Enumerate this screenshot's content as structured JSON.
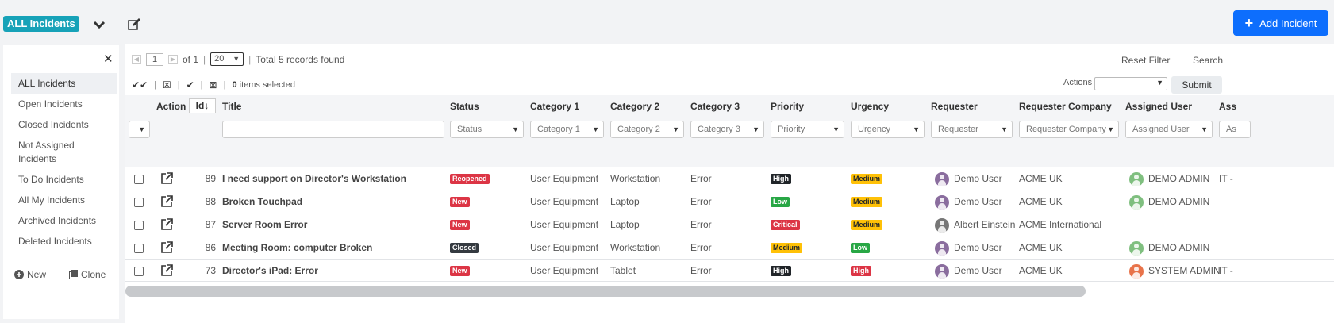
{
  "header": {
    "title": "ALL Incidents",
    "add_button": "Add Incident",
    "chevron_icon": "chevron-down-icon",
    "edit_icon": "edit-icon"
  },
  "sidebar": {
    "items": [
      {
        "label": "ALL Incidents",
        "active": true
      },
      {
        "label": "Open Incidents"
      },
      {
        "label": "Closed Incidents"
      },
      {
        "label": "Not Assigned Incidents"
      },
      {
        "label": "To Do Incidents"
      },
      {
        "label": "All My Incidents"
      },
      {
        "label": "Archived Incidents"
      },
      {
        "label": "Deleted Incidents"
      }
    ],
    "new_label": "New",
    "clone_label": "Clone"
  },
  "toolbar": {
    "page": "1",
    "of_pages": "of 1",
    "page_size": "20",
    "total": "Total 5 records found",
    "reset_filter": "Reset Filter",
    "search": "Search",
    "items_selected_count": "0",
    "items_selected_text": "items selected",
    "actions_label": "Actions",
    "submit": "Submit"
  },
  "columns": {
    "action": "Action",
    "id": "Id",
    "title": "Title",
    "status": "Status",
    "category1": "Category 1",
    "category2": "Category 2",
    "category3": "Category 3",
    "priority": "Priority",
    "urgency": "Urgency",
    "requester": "Requester",
    "requester_company": "Requester Company",
    "assigned_user": "Assigned User",
    "last": "Ass"
  },
  "filters": {
    "status": "Status",
    "category1": "Category 1",
    "category2": "Category 2",
    "category3": "Category 3",
    "priority": "Priority",
    "urgency": "Urgency",
    "requester": "Requester",
    "requester_company": "Requester Company",
    "assigned_user": "Assigned User",
    "last": "As"
  },
  "rows": [
    {
      "id": "89",
      "title": "I need support on Director's Workstation",
      "status": "Reopened",
      "status_color": "#dc3545",
      "cat1": "User Equipment",
      "cat2": "Workstation",
      "cat3": "Error",
      "priority": "High",
      "priority_color": "#212529",
      "urgency": "Medium",
      "urgency_color": "#ffc107",
      "requester": "Demo User",
      "requester_avatar": "#8a6d9e",
      "company": "ACME UK",
      "assigned": "DEMO ADMIN",
      "assigned_avatar": "#7fbf7f",
      "last": "IT -"
    },
    {
      "id": "88",
      "title": "Broken Touchpad",
      "status": "New",
      "status_color": "#dc3545",
      "cat1": "User Equipment",
      "cat2": "Laptop",
      "cat3": "Error",
      "priority": "Low",
      "priority_color": "#28a745",
      "urgency": "Medium",
      "urgency_color": "#ffc107",
      "requester": "Demo User",
      "requester_avatar": "#8a6d9e",
      "company": "ACME UK",
      "assigned": "DEMO ADMIN",
      "assigned_avatar": "#7fbf7f",
      "last": ""
    },
    {
      "id": "87",
      "title": "Server Room Error",
      "status": "New",
      "status_color": "#dc3545",
      "cat1": "User Equipment",
      "cat2": "Laptop",
      "cat3": "Error",
      "priority": "Critical",
      "priority_color": "#dc3545",
      "urgency": "Medium",
      "urgency_color": "#ffc107",
      "requester": "Albert Einstein",
      "requester_avatar": "#777777",
      "company": "ACME International",
      "assigned": "",
      "assigned_avatar": "",
      "last": ""
    },
    {
      "id": "86",
      "title": "Meeting Room: computer Broken",
      "status": "Closed",
      "status_color": "#343a40",
      "cat1": "User Equipment",
      "cat2": "Workstation",
      "cat3": "Error",
      "priority": "Medium",
      "priority_color": "#ffc107",
      "urgency": "Low",
      "urgency_color": "#28a745",
      "requester": "Demo User",
      "requester_avatar": "#8a6d9e",
      "company": "ACME UK",
      "assigned": "DEMO ADMIN",
      "assigned_avatar": "#7fbf7f",
      "last": ""
    },
    {
      "id": "73",
      "title": "Director's iPad: Error",
      "status": "New",
      "status_color": "#dc3545",
      "cat1": "User Equipment",
      "cat2": "Tablet",
      "cat3": "Error",
      "priority": "High",
      "priority_color": "#212529",
      "urgency": "High",
      "urgency_color": "#dc3545",
      "requester": "Demo User",
      "requester_avatar": "#8a6d9e",
      "company": "ACME UK",
      "assigned": "SYSTEM ADMIN",
      "assigned_avatar": "#e8734a",
      "last": "IT -"
    }
  ],
  "colors": {
    "accent": "#17a2b8",
    "primary": "#0d6efd"
  }
}
